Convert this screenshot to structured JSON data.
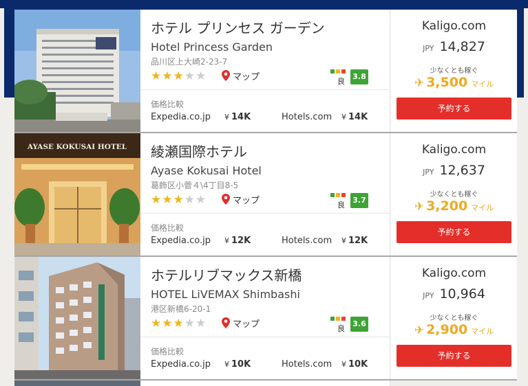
{
  "hotels": [
    {
      "name_ja": "ホテル プリンセス ガーデン",
      "name_en": "Hotel Princess Garden",
      "address": "品川区上大崎2-23-7",
      "stars": 3,
      "map_label": "マップ",
      "rating_word": "良",
      "rating": "3.8",
      "compare_label": "価格比較",
      "compare": [
        {
          "site": "Expedia.co.jp",
          "yen": "¥",
          "price": "14K"
        },
        {
          "site": "Hotels.com",
          "yen": "¥",
          "price": "14K"
        }
      ],
      "site": "Kaligo.com",
      "currency": "JPY",
      "price": "14,827",
      "earn_label": "少なくとも稼ぐ",
      "miles": "3,500",
      "miles_unit": "マイル",
      "book_label": "予約する"
    },
    {
      "name_ja": "綾瀬国際ホテル",
      "name_en": "Ayase Kokusai Hotel",
      "address": "葛飾区小菅４\\4丁目8-5",
      "photo_sign": "AYASE KOKUSAI HOTEL",
      "stars": 3,
      "map_label": "マップ",
      "rating_word": "良",
      "rating": "3.7",
      "compare_label": "価格比較",
      "compare": [
        {
          "site": "Expedia.co.jp",
          "yen": "¥",
          "price": "12K"
        },
        {
          "site": "Hotels.com",
          "yen": "¥",
          "price": "12K"
        }
      ],
      "site": "Kaligo.com",
      "currency": "JPY",
      "price": "12,637",
      "earn_label": "少なくとも稼ぐ",
      "miles": "3,200",
      "miles_unit": "マイル",
      "book_label": "予約する"
    },
    {
      "name_ja": "ホテルリブマックス新橋",
      "name_en": "HOTEL LiVEMAX Shimbashi",
      "address": "港区新橋6-20-1",
      "stars": 3,
      "map_label": "マップ",
      "rating_word": "良",
      "rating": "3.6",
      "compare_label": "価格比較",
      "compare": [
        {
          "site": "Expedia.co.jp",
          "yen": "¥",
          "price": "10K"
        },
        {
          "site": "Hotels.com",
          "yen": "¥",
          "price": "10K"
        }
      ],
      "site": "Kaligo.com",
      "currency": "JPY",
      "price": "10,964",
      "earn_label": "少なくとも稼ぐ",
      "miles": "2,900",
      "miles_unit": "マイル",
      "book_label": "予約する"
    }
  ],
  "colors": {
    "header_blue": "#0b2a6b",
    "book_red": "#e42e2a",
    "miles_gold": "#f0a91e",
    "star_gold": "#f0b51d",
    "rating_green": "#3fa336",
    "map_pin_red": "#e0302b"
  },
  "icons": {
    "map": "map-pin-icon",
    "miles": "airplane-icon",
    "star": "star-icon"
  }
}
